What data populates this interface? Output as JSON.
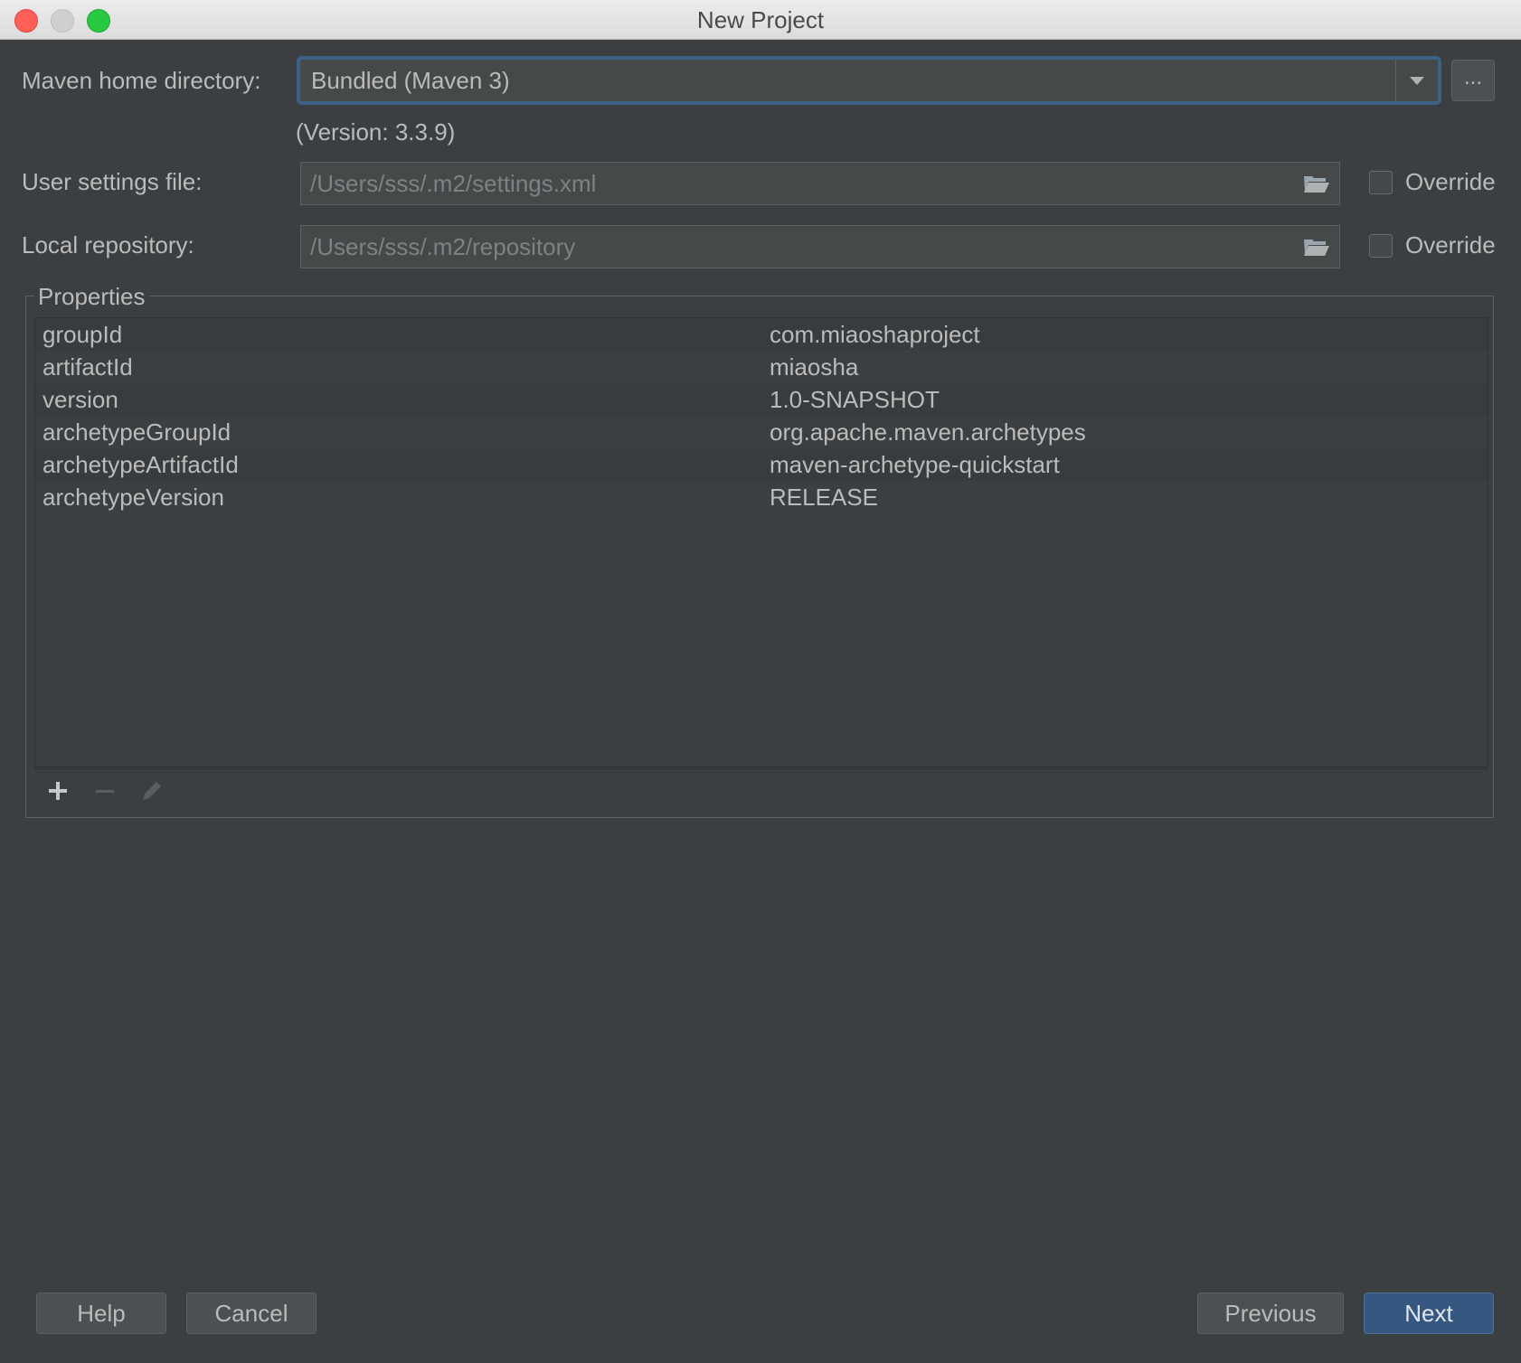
{
  "window": {
    "title": "New Project"
  },
  "maven_home": {
    "label": "Maven home directory:",
    "value": "Bundled (Maven 3)",
    "browse_label": "...",
    "version": "(Version: 3.3.9)"
  },
  "user_settings": {
    "label": "User settings file:",
    "path": "/Users/sss/.m2/settings.xml",
    "override_label": "Override",
    "override_checked": false
  },
  "local_repository": {
    "label": "Local repository:",
    "path": "/Users/sss/.m2/repository",
    "override_label": "Override",
    "override_checked": false
  },
  "properties": {
    "title": "Properties",
    "rows": [
      {
        "key": "groupId",
        "value": "com.miaoshaproject"
      },
      {
        "key": "artifactId",
        "value": "miaosha"
      },
      {
        "key": "version",
        "value": "1.0-SNAPSHOT"
      },
      {
        "key": "archetypeGroupId",
        "value": "org.apache.maven.archetypes"
      },
      {
        "key": "archetypeArtifactId",
        "value": "maven-archetype-quickstart"
      },
      {
        "key": "archetypeVersion",
        "value": "RELEASE"
      }
    ],
    "toolbar": [
      "plus-icon",
      "minus-icon",
      "pencil-icon"
    ]
  },
  "footer": {
    "help_label": "Help",
    "cancel_label": "Cancel",
    "previous_label": "Previous",
    "next_label": "Next"
  },
  "colors": {
    "background": "#3c3f41",
    "focus_border": "#3d6185",
    "primary_button": "#365880",
    "text": "#bbbbbb"
  }
}
